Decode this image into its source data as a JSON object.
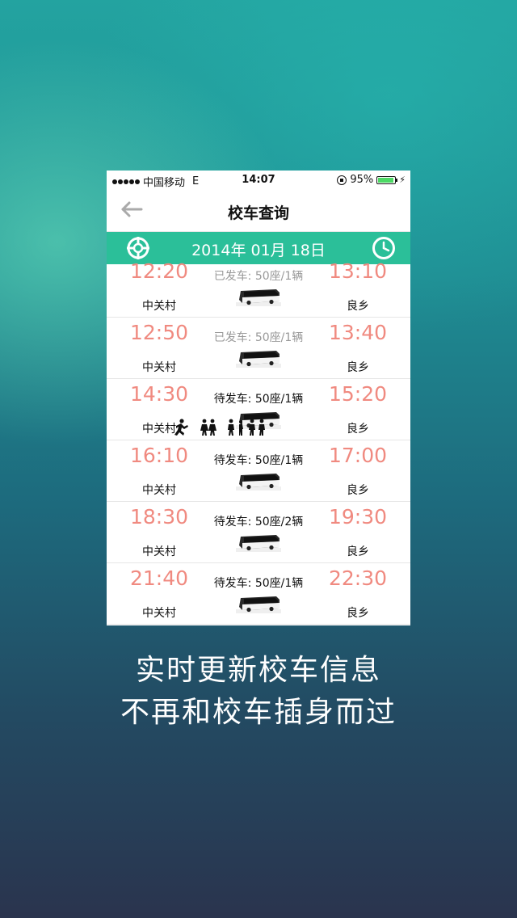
{
  "status_bar": {
    "carrier": "中国移动",
    "network": "E",
    "time": "14:07",
    "battery": "95%",
    "battery_level": 0.95
  },
  "navbar": {
    "title": "校车查询",
    "back_icon": "arrow-left-icon"
  },
  "date_bar": {
    "date": "2014年 01月 18日",
    "left_icon": "crosshair-icon",
    "right_icon": "clock-icon"
  },
  "trips": [
    {
      "depart_time": "12:20",
      "status": "已发车: 50座/1辆",
      "state": "departed",
      "arrive_time": "13:10",
      "from": "中关村",
      "to": "良乡"
    },
    {
      "depart_time": "12:50",
      "status": "已发车: 50座/1辆",
      "state": "departed",
      "arrive_time": "13:40",
      "from": "中关村",
      "to": "良乡"
    },
    {
      "depart_time": "14:30",
      "status": "待发车: 50座/1辆",
      "state": "pending",
      "arrive_time": "15:20",
      "from": "中关村",
      "to": "良乡"
    },
    {
      "depart_time": "16:10",
      "status": "待发车: 50座/1辆",
      "state": "pending",
      "arrive_time": "17:00",
      "from": "中关村",
      "to": "良乡"
    },
    {
      "depart_time": "18:30",
      "status": "待发车: 50座/2辆",
      "state": "pending",
      "arrive_time": "19:30",
      "from": "中关村",
      "to": "良乡"
    },
    {
      "depart_time": "21:40",
      "status": "待发车: 50座/1辆",
      "state": "pending",
      "arrive_time": "22:30",
      "from": "中关村",
      "to": "良乡"
    }
  ],
  "captions": {
    "line1": "实时更新校车信息",
    "line2": "不再和校车插身而过"
  },
  "colors": {
    "accent": "#2bbf99",
    "time_text": "#f08a80",
    "battery": "#4cd964"
  }
}
